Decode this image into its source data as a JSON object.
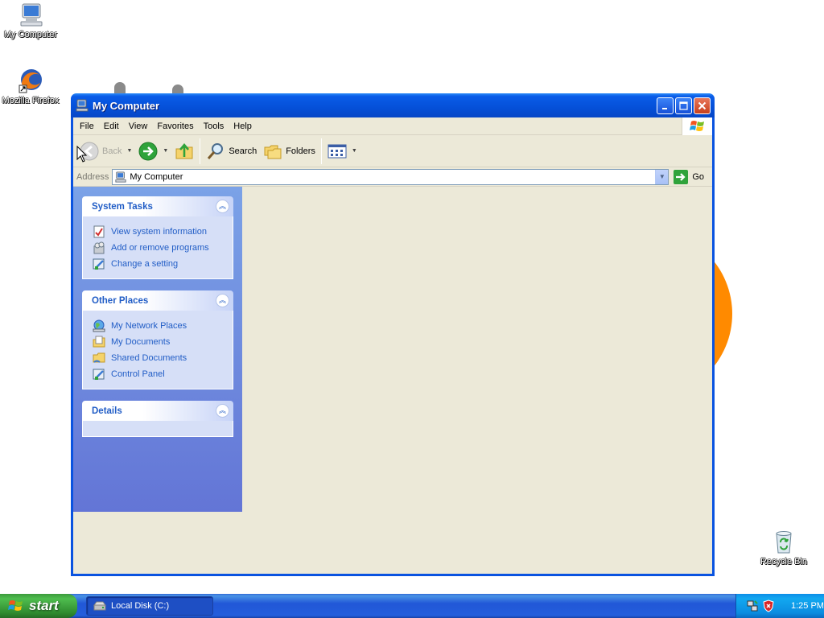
{
  "desktop": {
    "icons": [
      {
        "label": "My Computer"
      },
      {
        "label": "Mozilla Firefox"
      },
      {
        "label": "Recycle Bin"
      }
    ]
  },
  "window": {
    "title": "My Computer",
    "menu": [
      "File",
      "Edit",
      "View",
      "Favorites",
      "Tools",
      "Help"
    ],
    "toolbar": {
      "back": "Back",
      "search": "Search",
      "folders": "Folders"
    },
    "address": {
      "label": "Address",
      "value": "My Computer",
      "go": "Go"
    },
    "panels": {
      "system_tasks": {
        "title": "System Tasks",
        "items": [
          "View system information",
          "Add or remove programs",
          "Change a setting"
        ]
      },
      "other_places": {
        "title": "Other Places",
        "items": [
          "My Network Places",
          "My Documents",
          "Shared Documents",
          "Control Panel"
        ]
      },
      "details": {
        "title": "Details"
      }
    }
  },
  "taskbar": {
    "start": "start",
    "task_button": "Local Disk (C:)",
    "clock": "1:25 PM"
  },
  "colors": {
    "titlebar": "#0a5ce8",
    "taskpane_link": "#215dc6",
    "client_bg": "#ece9d8",
    "taskbar": "#245edc",
    "start": "#3c9a3c"
  }
}
